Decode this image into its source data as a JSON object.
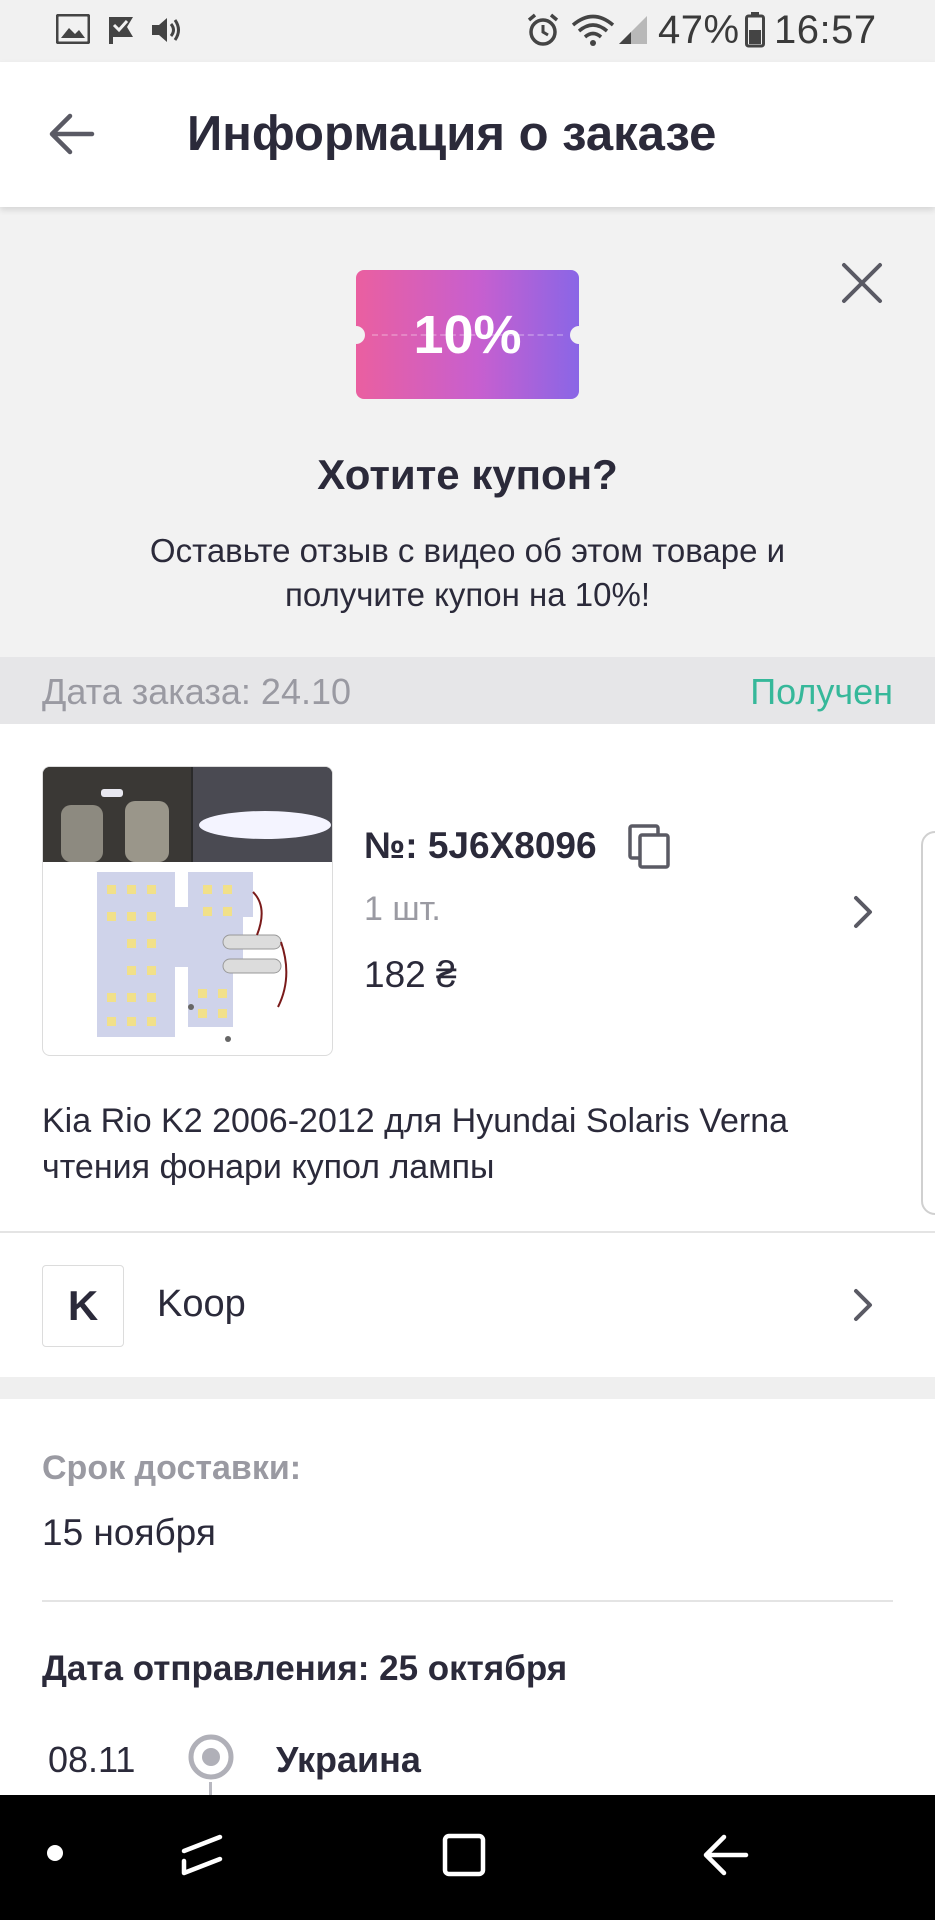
{
  "status_bar": {
    "battery": "47%",
    "time": "16:57",
    "icons": [
      "image-icon",
      "check-flag-icon",
      "volume-icon",
      "alarm-icon",
      "wifi-icon",
      "signal-icon",
      "battery-icon"
    ]
  },
  "header": {
    "title": "Информация о заказе",
    "back_icon": "arrow-left-icon"
  },
  "coupon": {
    "badge": "10%",
    "title": "Хотите купон?",
    "description": "Оставьте отзыв с видео об этом товаре и получите купон на 10%!",
    "gradient_from": "#ea5fa0",
    "gradient_to": "#8a66e6"
  },
  "order": {
    "date": "Дата заказа: 24.10",
    "status": "Получен",
    "status_color": "#36b89a"
  },
  "product": {
    "number": "№: 5J6X8096",
    "quantity": "1 шт.",
    "price": "182 ₴",
    "title": "Kia Rio K2 2006-2012 для Hyundai Solaris Verna чтения фонари купол лампы"
  },
  "store": {
    "initial": "K",
    "name": "Koop"
  },
  "delivery": {
    "label": "Срок доставки:",
    "value": "15 ноября",
    "ship_date": "Дата отправления: 25 октября",
    "tracking": [
      {
        "date": "08.11",
        "location": "Украина"
      }
    ]
  },
  "nav": {
    "icons": [
      "home-dot-icon",
      "recents-icon",
      "home-square-icon",
      "back-icon"
    ]
  }
}
